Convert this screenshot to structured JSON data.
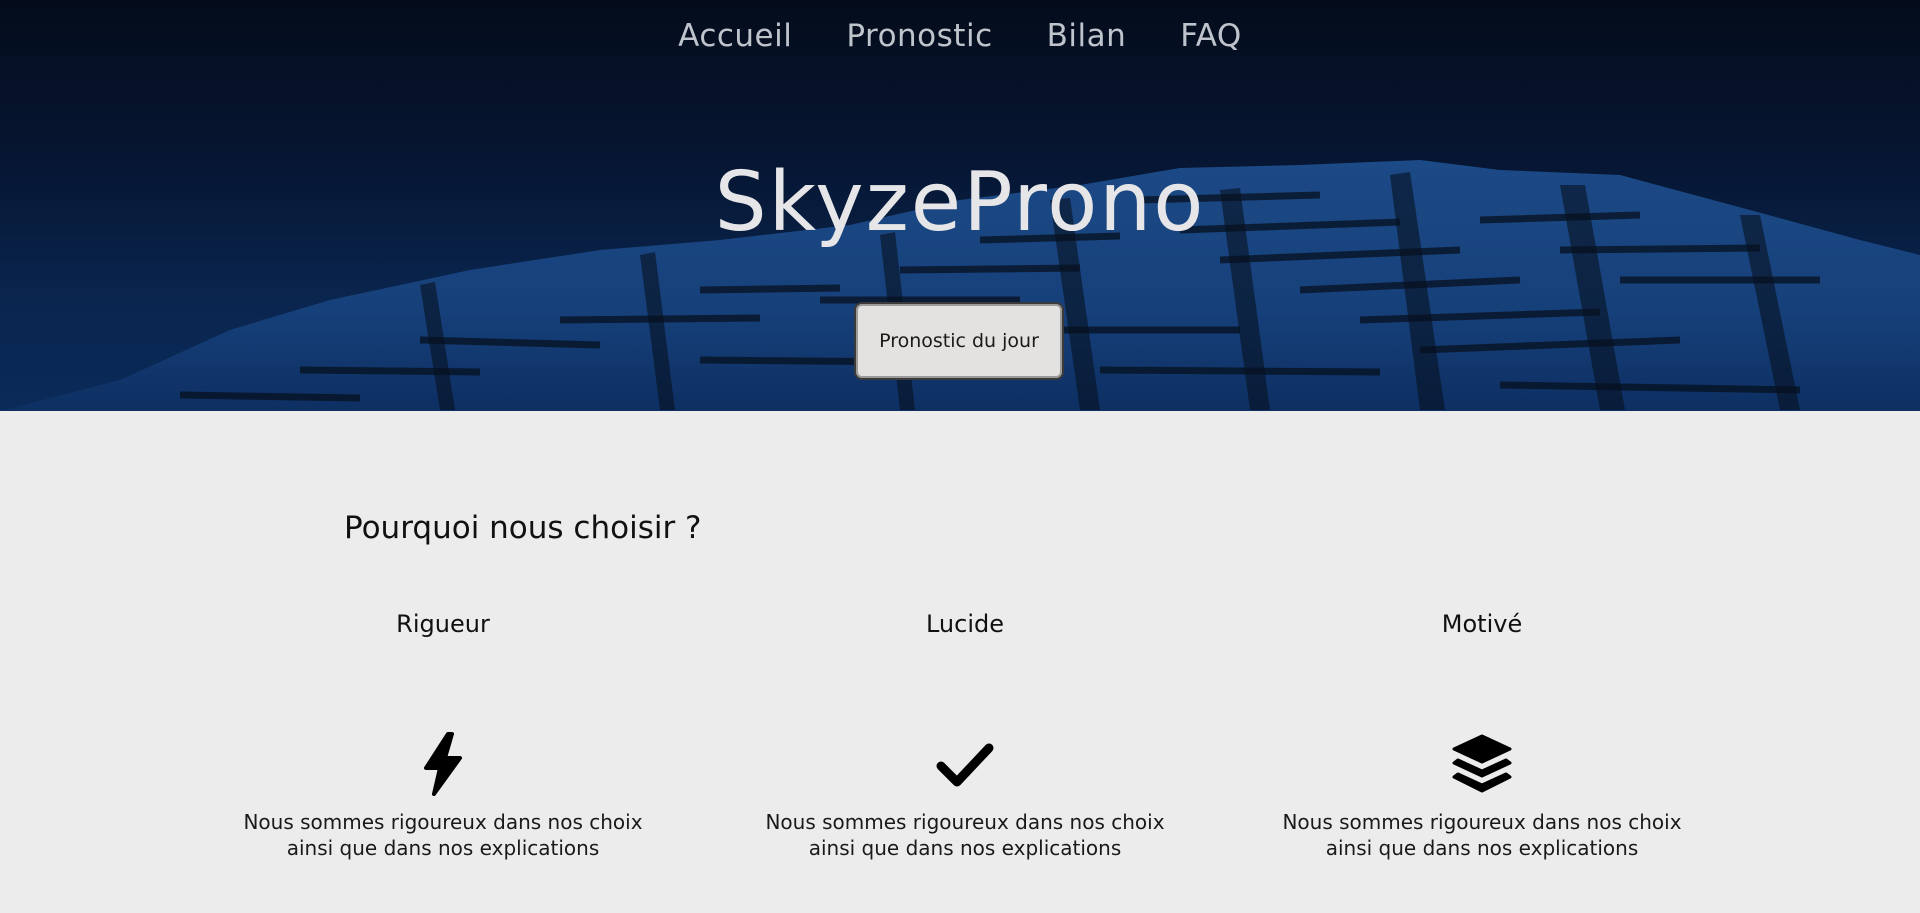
{
  "nav": {
    "items": [
      "Accueil",
      "Pronostic",
      "Bilan",
      "FAQ"
    ]
  },
  "hero": {
    "title": "SkyzeProno",
    "cta_label": "Pronostic du jour"
  },
  "why": {
    "title": "Pourquoi nous choisir ?",
    "features": [
      {
        "title": "Rigueur",
        "icon": "bolt-icon",
        "desc_line1": "Nous sommes rigoureux dans nos choix",
        "desc_line2": "ainsi que dans nos explications"
      },
      {
        "title": "Lucide",
        "icon": "check-icon",
        "desc_line1": "Nous sommes rigoureux dans nos choix",
        "desc_line2": "ainsi que dans nos explications"
      },
      {
        "title": "Motivé",
        "icon": "layers-icon",
        "desc_line1": "Nous sommes rigoureux dans nos choix",
        "desc_line2": "ainsi que dans nos explications"
      }
    ]
  },
  "colors": {
    "hero_dark": "#040c1b",
    "hero_blue": "#0b2a58",
    "page_bg": "#ececec",
    "button_bg": "#e4e2e0"
  }
}
